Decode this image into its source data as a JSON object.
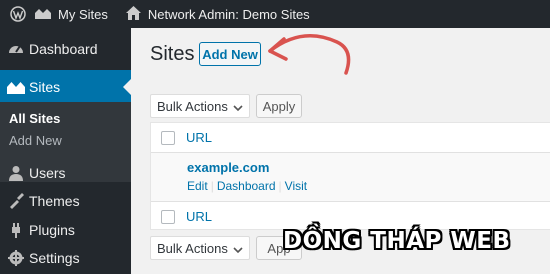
{
  "admin_bar": {
    "my_sites": "My Sites",
    "network_admin": "Network Admin: Demo Sites"
  },
  "sidebar": {
    "items": [
      {
        "label": "Dashboard",
        "icon": "dashboard-icon"
      },
      {
        "label": "Sites",
        "icon": "sites-icon"
      },
      {
        "label": "Users",
        "icon": "users-icon"
      },
      {
        "label": "Themes",
        "icon": "themes-icon"
      },
      {
        "label": "Plugins",
        "icon": "plugins-icon"
      },
      {
        "label": "Settings",
        "icon": "settings-icon"
      }
    ],
    "submenu": [
      {
        "label": "All Sites"
      },
      {
        "label": "Add New"
      }
    ]
  },
  "page": {
    "title": "Sites",
    "add_new": "Add New"
  },
  "bulk": {
    "label": "Bulk Actions",
    "apply": "Apply",
    "apply_partial": "App"
  },
  "table": {
    "column_url": "URL",
    "site_name": "example.com",
    "actions": [
      "Edit",
      "Dashboard",
      "Visit"
    ]
  },
  "watermark": "DỒNG THÁP WEB",
  "colors": {
    "admin_dark": "#23282d",
    "accent": "#0073aa",
    "annotation_arrow": "#d9534f"
  }
}
